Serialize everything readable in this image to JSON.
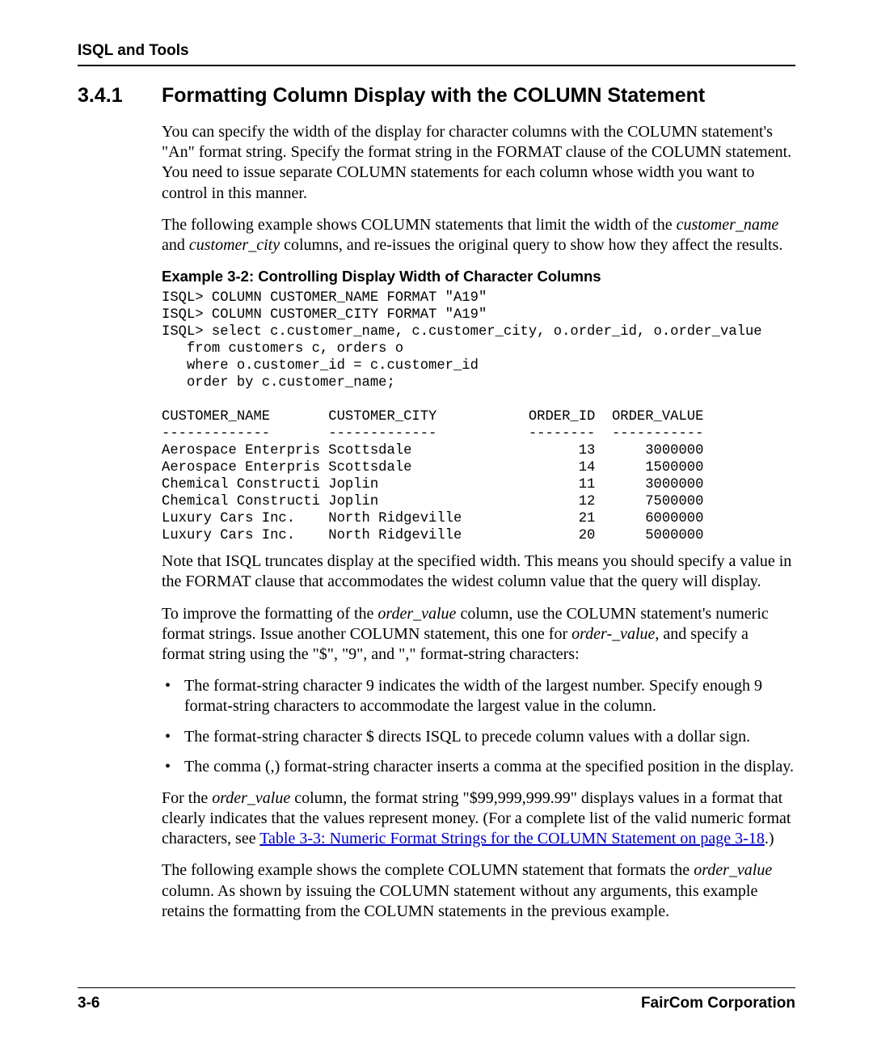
{
  "header": {
    "running_head": "ISQL and Tools"
  },
  "section": {
    "number": "3.4.1",
    "title": "Formatting Column Display with the COLUMN Statement"
  },
  "body": {
    "p1_a": "You can specify the width of the display for character columns with the COLUMN statement's \"An\" format string. Specify the format string in the FORMAT clause of the COLUMN statement. You need to issue separate COLUMN statements for each column whose width you want to control in this manner.",
    "p2_a": "The following example shows COLUMN statements that limit the width of the ",
    "p2_i1": "customer_name",
    "p2_b": " and ",
    "p2_i2": "customer_city",
    "p2_c": " columns, and re-issues the original query to show how they affect the results.",
    "example_caption": "Example 3-2:  Controlling Display Width of Character Columns",
    "code_block": "ISQL> COLUMN CUSTOMER_NAME FORMAT \"A19\"\nISQL> COLUMN CUSTOMER_CITY FORMAT \"A19\"\nISQL> select c.customer_name, c.customer_city, o.order_id, o.order_value\n   from customers c, orders o\n   where o.customer_id = c.customer_id\n   order by c.customer_name;\n\nCUSTOMER_NAME       CUSTOMER_CITY           ORDER_ID  ORDER_VALUE\n-------------       -------------           --------  -----------\nAerospace Enterpris Scottsdale                    13      3000000\nAerospace Enterpris Scottsdale                    14      1500000\nChemical Constructi Joplin                        11      3000000\nChemical Constructi Joplin                        12      7500000\nLuxury Cars Inc.    North Ridgeville              21      6000000\nLuxury Cars Inc.    North Ridgeville              20      5000000",
    "p3": "Note that ISQL truncates display at the specified width. This means you should specify a value in the FORMAT clause that accommodates the widest column value that the query will display.",
    "p4_a": "To improve the formatting of the ",
    "p4_i1": "order_value",
    "p4_b": " column, use the COLUMN statement's numeric format strings. Issue another COLUMN statement, this one for ",
    "p4_i2": "order-_value",
    "p4_c": ", and specify a format string using the \"$\", \"9\", and \",\" format-string characters:",
    "bullets": [
      "The format-string character 9 indicates the width of the largest number. Specify enough 9 format-string characters to accommodate the largest value in the column.",
      "The format-string character $ directs ISQL to precede column values with a dollar sign.",
      "The comma (,) format-string character inserts a comma at the specified position in the display."
    ],
    "p5_a": "For the ",
    "p5_i1": "order_value",
    "p5_b": " column, the format string \"$99,999,999.99\" displays values in a format that clearly indicates that the values represent money. (For a complete list of the valid numeric format characters, see ",
    "p5_link": "Table 3-3: Numeric Format Strings for the COLUMN Statement on page 3-18",
    "p5_c": ".)",
    "p6_a": "The following example shows the complete COLUMN statement that formats the ",
    "p6_i1": "order_value",
    "p6_b": " column. As shown by issuing the COLUMN statement without any arguments, this example retains the formatting from the COLUMN statements in the previous example."
  },
  "footer": {
    "page_num": "3-6",
    "company": "FairCom Corporation"
  }
}
